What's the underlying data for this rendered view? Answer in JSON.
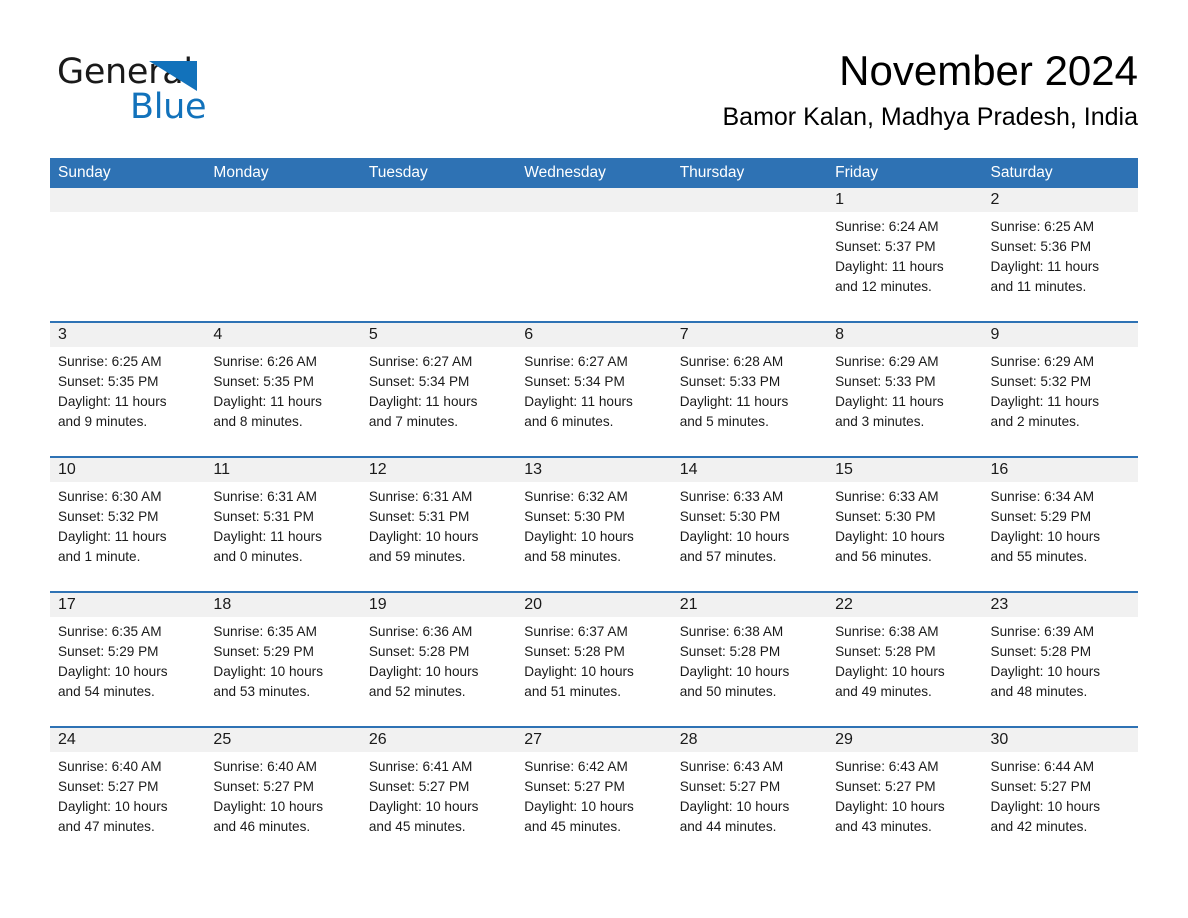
{
  "brand": {
    "name_part1": "General",
    "name_part2": "Blue",
    "accent_color": "#1272bb"
  },
  "header": {
    "title": "November 2024",
    "location": "Bamor Kalan, Madhya Pradesh, India"
  },
  "theme": {
    "header_blue": "#2e72b4",
    "day_band_gray": "#f1f1f1",
    "separator_blue": "#2e72b4"
  },
  "weekdays": [
    "Sunday",
    "Monday",
    "Tuesday",
    "Wednesday",
    "Thursday",
    "Friday",
    "Saturday"
  ],
  "weeks": [
    [
      {
        "day": "",
        "sunrise": "",
        "sunset": "",
        "daylight_line1": "",
        "daylight_line2": ""
      },
      {
        "day": "",
        "sunrise": "",
        "sunset": "",
        "daylight_line1": "",
        "daylight_line2": ""
      },
      {
        "day": "",
        "sunrise": "",
        "sunset": "",
        "daylight_line1": "",
        "daylight_line2": ""
      },
      {
        "day": "",
        "sunrise": "",
        "sunset": "",
        "daylight_line1": "",
        "daylight_line2": ""
      },
      {
        "day": "",
        "sunrise": "",
        "sunset": "",
        "daylight_line1": "",
        "daylight_line2": ""
      },
      {
        "day": "1",
        "sunrise": "Sunrise: 6:24 AM",
        "sunset": "Sunset: 5:37 PM",
        "daylight_line1": "Daylight: 11 hours",
        "daylight_line2": "and 12 minutes."
      },
      {
        "day": "2",
        "sunrise": "Sunrise: 6:25 AM",
        "sunset": "Sunset: 5:36 PM",
        "daylight_line1": "Daylight: 11 hours",
        "daylight_line2": "and 11 minutes."
      }
    ],
    [
      {
        "day": "3",
        "sunrise": "Sunrise: 6:25 AM",
        "sunset": "Sunset: 5:35 PM",
        "daylight_line1": "Daylight: 11 hours",
        "daylight_line2": "and 9 minutes."
      },
      {
        "day": "4",
        "sunrise": "Sunrise: 6:26 AM",
        "sunset": "Sunset: 5:35 PM",
        "daylight_line1": "Daylight: 11 hours",
        "daylight_line2": "and 8 minutes."
      },
      {
        "day": "5",
        "sunrise": "Sunrise: 6:27 AM",
        "sunset": "Sunset: 5:34 PM",
        "daylight_line1": "Daylight: 11 hours",
        "daylight_line2": "and 7 minutes."
      },
      {
        "day": "6",
        "sunrise": "Sunrise: 6:27 AM",
        "sunset": "Sunset: 5:34 PM",
        "daylight_line1": "Daylight: 11 hours",
        "daylight_line2": "and 6 minutes."
      },
      {
        "day": "7",
        "sunrise": "Sunrise: 6:28 AM",
        "sunset": "Sunset: 5:33 PM",
        "daylight_line1": "Daylight: 11 hours",
        "daylight_line2": "and 5 minutes."
      },
      {
        "day": "8",
        "sunrise": "Sunrise: 6:29 AM",
        "sunset": "Sunset: 5:33 PM",
        "daylight_line1": "Daylight: 11 hours",
        "daylight_line2": "and 3 minutes."
      },
      {
        "day": "9",
        "sunrise": "Sunrise: 6:29 AM",
        "sunset": "Sunset: 5:32 PM",
        "daylight_line1": "Daylight: 11 hours",
        "daylight_line2": "and 2 minutes."
      }
    ],
    [
      {
        "day": "10",
        "sunrise": "Sunrise: 6:30 AM",
        "sunset": "Sunset: 5:32 PM",
        "daylight_line1": "Daylight: 11 hours",
        "daylight_line2": "and 1 minute."
      },
      {
        "day": "11",
        "sunrise": "Sunrise: 6:31 AM",
        "sunset": "Sunset: 5:31 PM",
        "daylight_line1": "Daylight: 11 hours",
        "daylight_line2": "and 0 minutes."
      },
      {
        "day": "12",
        "sunrise": "Sunrise: 6:31 AM",
        "sunset": "Sunset: 5:31 PM",
        "daylight_line1": "Daylight: 10 hours",
        "daylight_line2": "and 59 minutes."
      },
      {
        "day": "13",
        "sunrise": "Sunrise: 6:32 AM",
        "sunset": "Sunset: 5:30 PM",
        "daylight_line1": "Daylight: 10 hours",
        "daylight_line2": "and 58 minutes."
      },
      {
        "day": "14",
        "sunrise": "Sunrise: 6:33 AM",
        "sunset": "Sunset: 5:30 PM",
        "daylight_line1": "Daylight: 10 hours",
        "daylight_line2": "and 57 minutes."
      },
      {
        "day": "15",
        "sunrise": "Sunrise: 6:33 AM",
        "sunset": "Sunset: 5:30 PM",
        "daylight_line1": "Daylight: 10 hours",
        "daylight_line2": "and 56 minutes."
      },
      {
        "day": "16",
        "sunrise": "Sunrise: 6:34 AM",
        "sunset": "Sunset: 5:29 PM",
        "daylight_line1": "Daylight: 10 hours",
        "daylight_line2": "and 55 minutes."
      }
    ],
    [
      {
        "day": "17",
        "sunrise": "Sunrise: 6:35 AM",
        "sunset": "Sunset: 5:29 PM",
        "daylight_line1": "Daylight: 10 hours",
        "daylight_line2": "and 54 minutes."
      },
      {
        "day": "18",
        "sunrise": "Sunrise: 6:35 AM",
        "sunset": "Sunset: 5:29 PM",
        "daylight_line1": "Daylight: 10 hours",
        "daylight_line2": "and 53 minutes."
      },
      {
        "day": "19",
        "sunrise": "Sunrise: 6:36 AM",
        "sunset": "Sunset: 5:28 PM",
        "daylight_line1": "Daylight: 10 hours",
        "daylight_line2": "and 52 minutes."
      },
      {
        "day": "20",
        "sunrise": "Sunrise: 6:37 AM",
        "sunset": "Sunset: 5:28 PM",
        "daylight_line1": "Daylight: 10 hours",
        "daylight_line2": "and 51 minutes."
      },
      {
        "day": "21",
        "sunrise": "Sunrise: 6:38 AM",
        "sunset": "Sunset: 5:28 PM",
        "daylight_line1": "Daylight: 10 hours",
        "daylight_line2": "and 50 minutes."
      },
      {
        "day": "22",
        "sunrise": "Sunrise: 6:38 AM",
        "sunset": "Sunset: 5:28 PM",
        "daylight_line1": "Daylight: 10 hours",
        "daylight_line2": "and 49 minutes."
      },
      {
        "day": "23",
        "sunrise": "Sunrise: 6:39 AM",
        "sunset": "Sunset: 5:28 PM",
        "daylight_line1": "Daylight: 10 hours",
        "daylight_line2": "and 48 minutes."
      }
    ],
    [
      {
        "day": "24",
        "sunrise": "Sunrise: 6:40 AM",
        "sunset": "Sunset: 5:27 PM",
        "daylight_line1": "Daylight: 10 hours",
        "daylight_line2": "and 47 minutes."
      },
      {
        "day": "25",
        "sunrise": "Sunrise: 6:40 AM",
        "sunset": "Sunset: 5:27 PM",
        "daylight_line1": "Daylight: 10 hours",
        "daylight_line2": "and 46 minutes."
      },
      {
        "day": "26",
        "sunrise": "Sunrise: 6:41 AM",
        "sunset": "Sunset: 5:27 PM",
        "daylight_line1": "Daylight: 10 hours",
        "daylight_line2": "and 45 minutes."
      },
      {
        "day": "27",
        "sunrise": "Sunrise: 6:42 AM",
        "sunset": "Sunset: 5:27 PM",
        "daylight_line1": "Daylight: 10 hours",
        "daylight_line2": "and 45 minutes."
      },
      {
        "day": "28",
        "sunrise": "Sunrise: 6:43 AM",
        "sunset": "Sunset: 5:27 PM",
        "daylight_line1": "Daylight: 10 hours",
        "daylight_line2": "and 44 minutes."
      },
      {
        "day": "29",
        "sunrise": "Sunrise: 6:43 AM",
        "sunset": "Sunset: 5:27 PM",
        "daylight_line1": "Daylight: 10 hours",
        "daylight_line2": "and 43 minutes."
      },
      {
        "day": "30",
        "sunrise": "Sunrise: 6:44 AM",
        "sunset": "Sunset: 5:27 PM",
        "daylight_line1": "Daylight: 10 hours",
        "daylight_line2": "and 42 minutes."
      }
    ]
  ]
}
